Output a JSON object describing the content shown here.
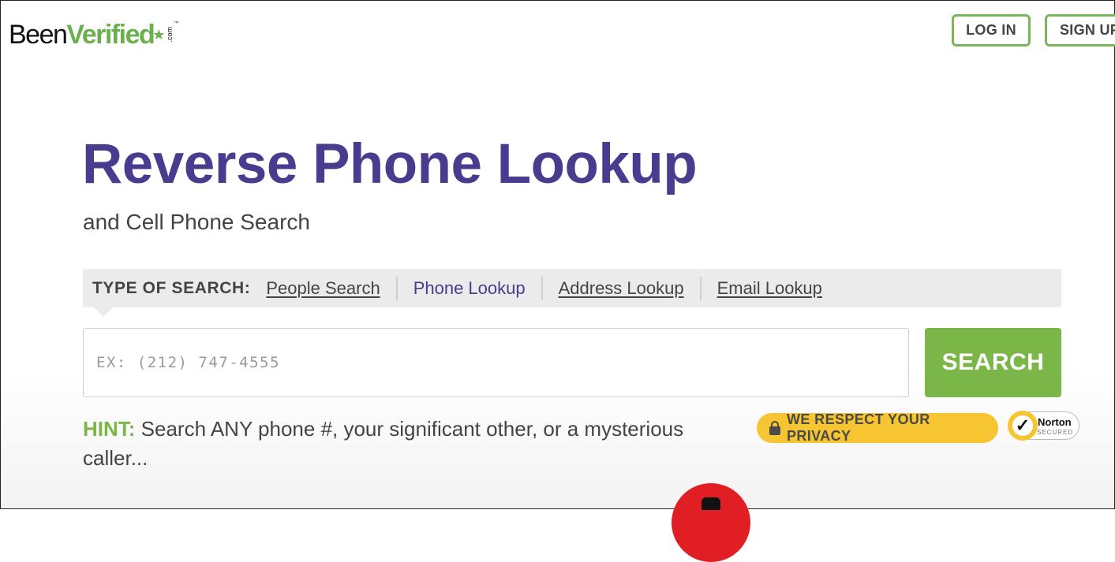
{
  "header": {
    "logo": {
      "part1": "Been",
      "part2": "Verified",
      "dotcom": ".com",
      "tm": "™"
    },
    "login_label": "LOG IN",
    "signup_label": "SIGN UP"
  },
  "hero": {
    "title": "Reverse Phone Lookup",
    "subtitle": "and Cell Phone Search"
  },
  "search_type": {
    "label": "TYPE OF SEARCH:",
    "tabs": [
      {
        "label": "People Search",
        "active": false
      },
      {
        "label": "Phone Lookup",
        "active": true
      },
      {
        "label": "Address Lookup",
        "active": false
      },
      {
        "label": "Email Lookup",
        "active": false
      }
    ]
  },
  "search": {
    "placeholder": "EX: (212) 747-4555",
    "value": "",
    "button_label": "SEARCH"
  },
  "hint": {
    "label": "HINT:",
    "text": " Search ANY phone #, your significant other, or a mysterious caller..."
  },
  "badges": {
    "privacy": "WE RESPECT YOUR PRIVACY",
    "norton_name": "Norton",
    "norton_sub": "SECURED"
  },
  "colors": {
    "brand_green": "#7ab648",
    "title_purple": "#4b3b8f",
    "privacy_yellow": "#f7c531",
    "red_accent": "#e01e23"
  }
}
